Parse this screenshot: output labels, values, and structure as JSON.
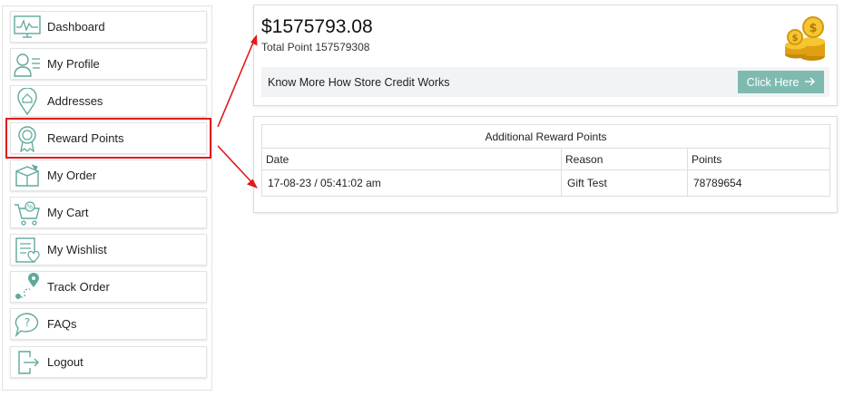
{
  "sidebar": {
    "items": [
      {
        "label": "Dashboard",
        "icon": "dashboard-icon"
      },
      {
        "label": "My Profile",
        "icon": "profile-icon"
      },
      {
        "label": "Addresses",
        "icon": "address-pin-icon"
      },
      {
        "label": "Reward Points",
        "icon": "award-ribbon-icon",
        "active": true
      },
      {
        "label": "My Order",
        "icon": "order-box-icon"
      },
      {
        "label": "My Cart",
        "icon": "cart-icon"
      },
      {
        "label": "My Wishlist",
        "icon": "wishlist-icon"
      },
      {
        "label": "Track Order",
        "icon": "track-route-icon"
      },
      {
        "label": "FAQs",
        "icon": "faq-bubble-icon"
      },
      {
        "label": "Logout",
        "icon": "logout-icon"
      }
    ]
  },
  "credit": {
    "amount": "$1575793.08",
    "total_points": "Total Point 157579308",
    "info_text": "Know More How Store Credit Works",
    "button_label": "Click Here"
  },
  "rewards_table": {
    "caption": "Additional Reward Points",
    "headers": [
      "Date",
      "Reason",
      "Points"
    ],
    "rows": [
      [
        "17-08-23 / 05:41:02 am",
        "Gift Test",
        "78789654"
      ]
    ]
  },
  "colors": {
    "accent": "#7fbab0",
    "icon_teal": "#5fa89c",
    "annotation_red": "#e01b1b"
  }
}
